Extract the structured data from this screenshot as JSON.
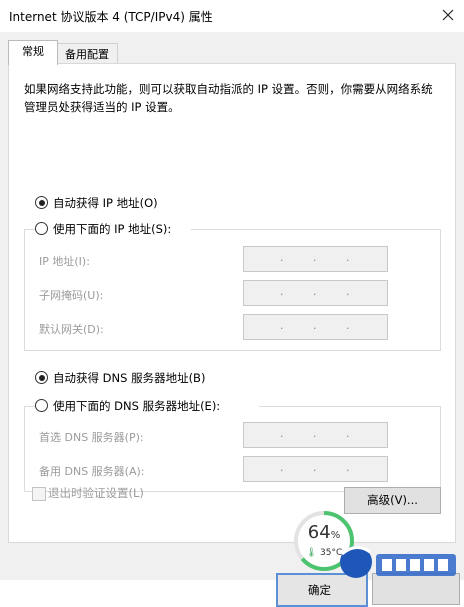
{
  "window": {
    "title": "Internet 协议版本 4 (TCP/IPv4) 属性"
  },
  "tabs": [
    {
      "label": "常规",
      "active": true
    },
    {
      "label": "备用配置",
      "active": false
    }
  ],
  "description": "如果网络支持此功能，则可以获取自动指派的 IP 设置。否则，你需要从网络系统管理员处获得适当的 IP 设置。",
  "ip": {
    "auto_label": "自动获得 IP 地址(O)",
    "auto_selected": true,
    "manual_label": "使用下面的 IP 地址(S):",
    "fields": [
      {
        "label": "IP 地址(I):"
      },
      {
        "label": "子网掩码(U):"
      },
      {
        "label": "默认网关(D):"
      }
    ]
  },
  "dns": {
    "auto_label": "自动获得 DNS 服务器地址(B)",
    "auto_selected": true,
    "manual_label": "使用下面的 DNS 服务器地址(E):",
    "fields": [
      {
        "label": "首选 DNS 服务器(P):"
      },
      {
        "label": "备用 DNS 服务器(A):"
      }
    ]
  },
  "validate_checkbox": {
    "label": "退出时验证设置(L)",
    "checked": false,
    "disabled": true
  },
  "advanced_button": {
    "label": "高级(V)..."
  },
  "ok_button": {
    "label": "确定"
  },
  "monitor_widget": {
    "percent": "64",
    "percent_sign": "%",
    "temperature": "35°C",
    "ring_fraction": 0.64
  },
  "colors": {
    "accent": "#5b8fd6",
    "widget_ring": "#4cc46f"
  }
}
